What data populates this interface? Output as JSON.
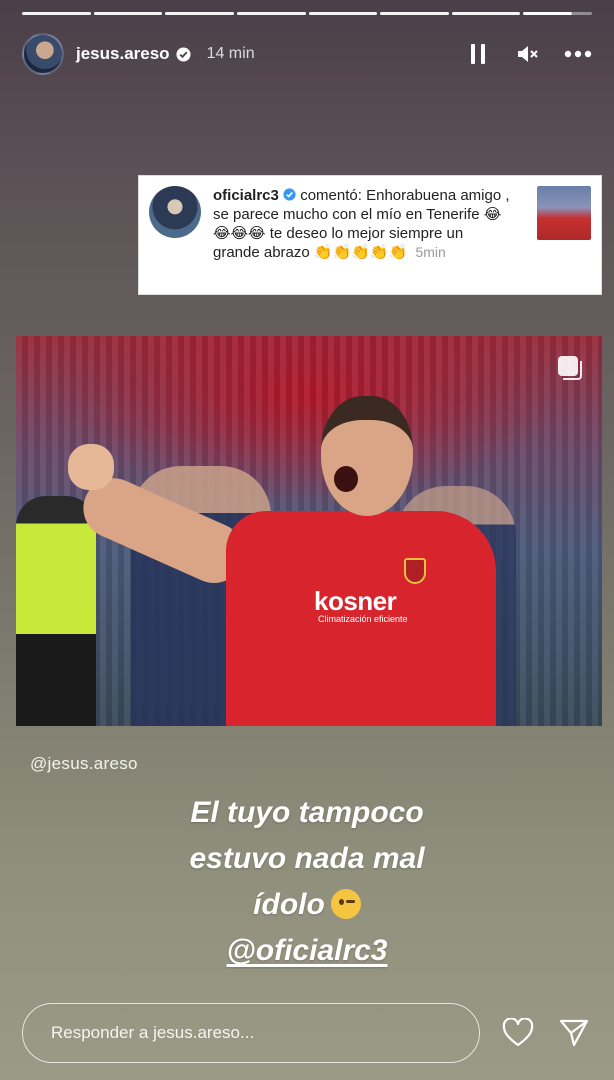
{
  "story": {
    "segments_total": 8,
    "segments_viewed": 7,
    "username": "jesus.areso",
    "verified": true,
    "time_ago": "14 min",
    "controls": {
      "pause_icon": "pause-icon",
      "mute_icon": "muted-speaker-icon",
      "more_icon": "more-icon"
    }
  },
  "comment_card": {
    "username": "oficialrc3",
    "action": "comentó:",
    "text": "Enhorabuena amigo , se parece mucho con el mío en Tenerife 😂😂😂😂 te deseo lo mejor siempre un grande abrazo 👏👏👏👏👏",
    "time": "5min"
  },
  "mention": "@jesus.areso",
  "caption": {
    "line1": "El tuyo tampoco",
    "line2": "estuvo nada mal",
    "line3": "ídolo",
    "tag": "@oficialrc3"
  },
  "photo": {
    "sponsor": "kosner",
    "sponsor_sub": "Climatización eficiente"
  },
  "reply": {
    "placeholder": "Responder a jesus.areso..."
  },
  "colors": {
    "background_top": "#4a3f48",
    "background_bottom": "#9a9a86",
    "verified_badge": "#3897f0",
    "jersey_red": "#d8242c"
  }
}
